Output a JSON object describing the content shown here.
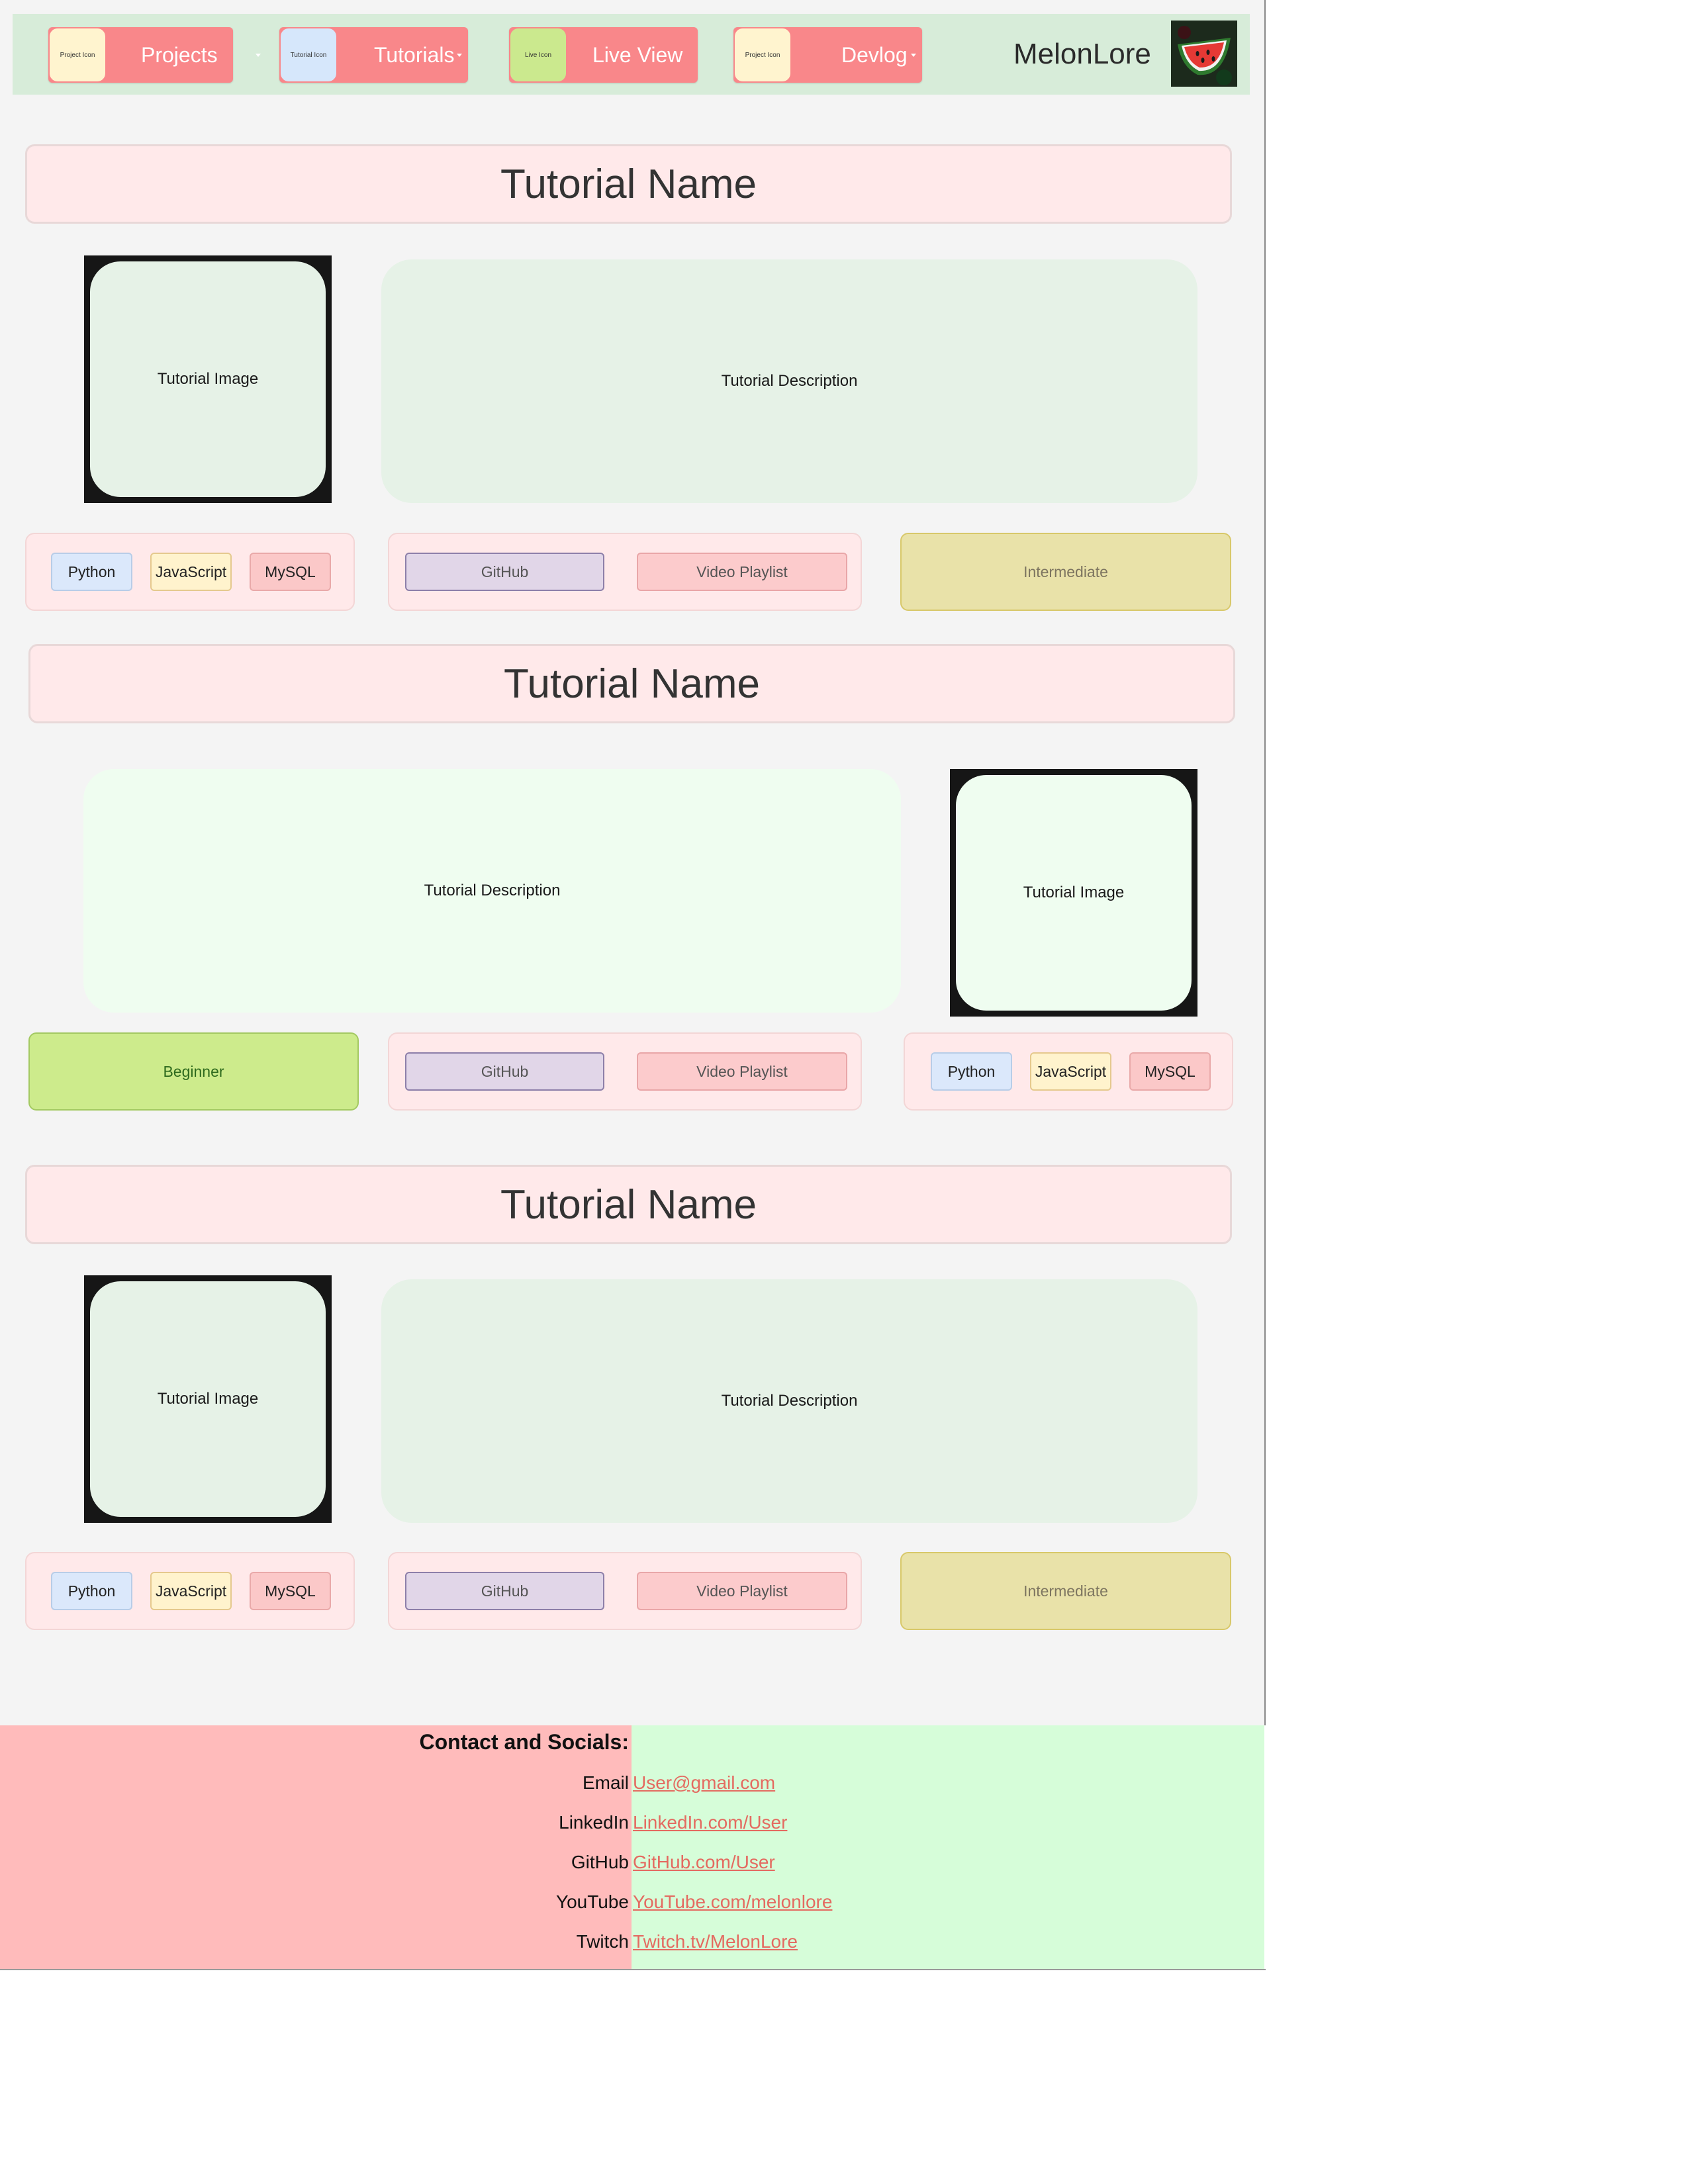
{
  "nav": {
    "items": [
      {
        "icon_label": "Project Icon",
        "label": "Projects",
        "has_dropdown": true,
        "icon_color": "#fff4cf"
      },
      {
        "icon_label": "Tutorial Icon",
        "label": "Tutorials",
        "has_dropdown": true,
        "icon_color": "#d6e7fb"
      },
      {
        "icon_label": "Live Icon",
        "label": "Live View",
        "has_dropdown": false,
        "icon_color": "#cbe98e"
      },
      {
        "icon_label": "Project Icon",
        "label": "Devlog",
        "has_dropdown": true,
        "icon_color": "#fff4cf"
      }
    ],
    "brand": "MelonLore",
    "logo_icon": "watermelon-logo-icon"
  },
  "tutorials": [
    {
      "title": "Tutorial Name",
      "image_label": "Tutorial Image",
      "description": "Tutorial Description",
      "tags": [
        "Python",
        "JavaScript",
        "MySQL"
      ],
      "links": {
        "github": "GitHub",
        "video": "Video Playlist"
      },
      "level": "Intermediate"
    },
    {
      "title": "Tutorial Name",
      "image_label": "Tutorial Image",
      "description": "Tutorial Description",
      "tags": [
        "Python",
        "JavaScript",
        "MySQL"
      ],
      "links": {
        "github": "GitHub",
        "video": "Video Playlist"
      },
      "level": "Beginner"
    },
    {
      "title": "Tutorial Name",
      "image_label": "Tutorial Image",
      "description": "Tutorial Description",
      "tags": [
        "Python",
        "JavaScript",
        "MySQL"
      ],
      "links": {
        "github": "GitHub",
        "video": "Video Playlist"
      },
      "level": "Intermediate"
    }
  ],
  "footer": {
    "heading": "Contact and Socials:",
    "contacts": [
      {
        "label": "Email",
        "link": "User@gmail.com"
      },
      {
        "label": "LinkedIn",
        "link": "LinkedIn.com/User"
      },
      {
        "label": "GitHub",
        "link": "GitHub.com/User"
      },
      {
        "label": "YouTube",
        "link": "YouTube.com/melonlore"
      },
      {
        "label": "Twitch",
        "link": "Twitch.tv/MelonLore"
      }
    ]
  },
  "colors": {
    "nav_bg": "#d7ecd9",
    "nav_button": "#f9878a",
    "title_bg": "#ffe9ea",
    "footer_left": "#ffbbbb",
    "footer_right": "#d6fdd9",
    "link": "#e46a60"
  }
}
